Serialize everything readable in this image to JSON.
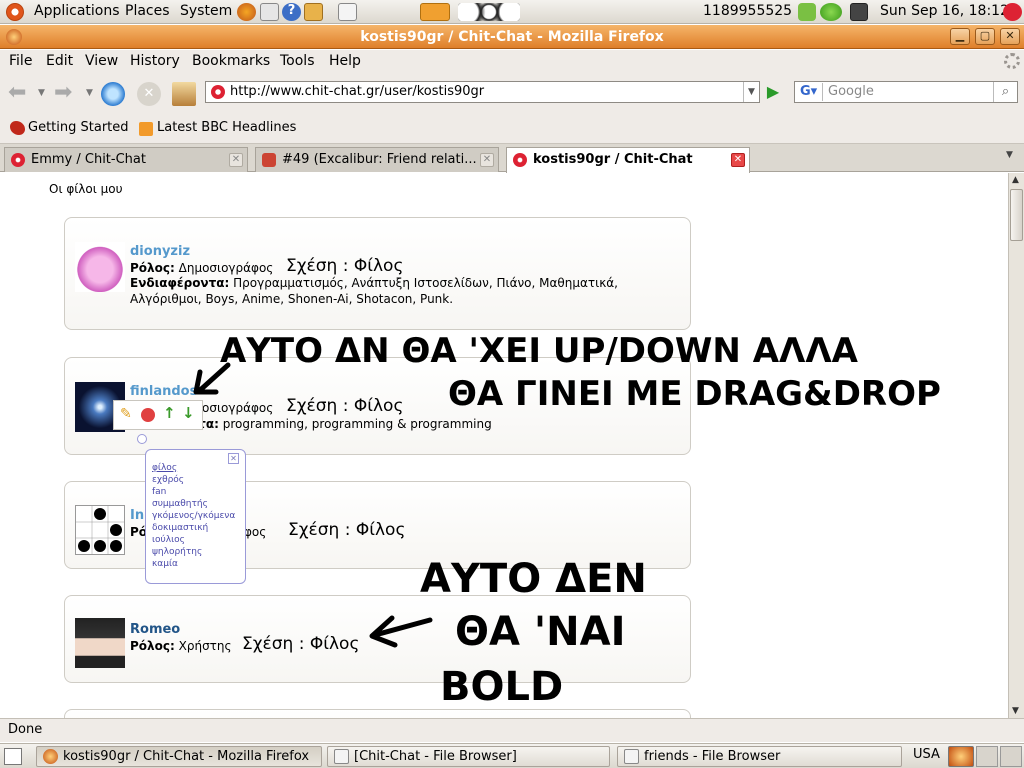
{
  "top_panel": {
    "menus": [
      "Applications",
      "Places",
      "System"
    ],
    "counter": "1189955525",
    "clock": "Sun Sep 16, 18:12"
  },
  "window": {
    "title": "kostis90gr / Chit-Chat - Mozilla Firefox",
    "menu": [
      "File",
      "Edit",
      "View",
      "History",
      "Bookmarks",
      "Tools",
      "Help"
    ]
  },
  "nav": {
    "url": "http://www.chit-chat.gr/user/kostis90gr",
    "search_placeholder": "Google"
  },
  "bookmarks": [
    "Getting Started",
    "Latest BBC Headlines"
  ],
  "tabs": [
    {
      "label": "Emmy / Chit-Chat"
    },
    {
      "label": "#49 (Excalibur: Friend relati..."
    },
    {
      "label": "kostis90gr / Chit-Chat"
    }
  ],
  "page": {
    "heading": "Οι φίλοι μου",
    "role_label": "Ρόλος:",
    "relation_label": "Σχέση",
    "interests_label": "Ενδιαφέροντα:",
    "friends": [
      {
        "name": "dionyziz",
        "role": "Δημοσιογράφος",
        "relation": "Φίλος",
        "interests": "Προγραμματισμός, Ανάπτυξη Ιστοσελίδων, Πιάνο, Μαθηματικά, Αλγόριθμοι, Boys, Anime, Shonen-Ai, Shotacon, Punk."
      },
      {
        "name": "finlandos",
        "role": "οσιογράφος",
        "relation": "Φίλος",
        "interests_label_partial": "ντα:",
        "interests": "programming, programming & programming"
      },
      {
        "name": "In",
        "role": "φος",
        "relation": "Φίλος"
      },
      {
        "name": "Romeo",
        "role": "Χρήστης",
        "relation": "Φίλος"
      }
    ],
    "relation_options": [
      "φίλος",
      "εχθρός",
      "fan",
      "συμμαθητής",
      "γκόμενος/γκόμενα",
      "δοκιμαστική",
      "ιούλιος",
      "ψηλορήτης",
      "καμία"
    ]
  },
  "status": "Done",
  "taskbar": {
    "items": [
      "kostis90gr / Chit-Chat - Mozilla Firefox",
      "[Chit-Chat - File Browser]",
      "friends - File Browser"
    ],
    "keyboard": "USA"
  },
  "annotations": {
    "note1_line1": "ΑΥΤΟ ΔΝ ΘΑ 'ΧΕΙ UP/DOWN ΑΛΛΑ",
    "note1_line2": "ΘΑ ΓΙΝΕΙ ΜΕ DRAG&DROP",
    "note2_line1": "ΑΥΤΟ ΔΕΝ",
    "note2_line2": "ΘΑ 'ΝΑΙ",
    "note2_line3": "BOLD"
  }
}
